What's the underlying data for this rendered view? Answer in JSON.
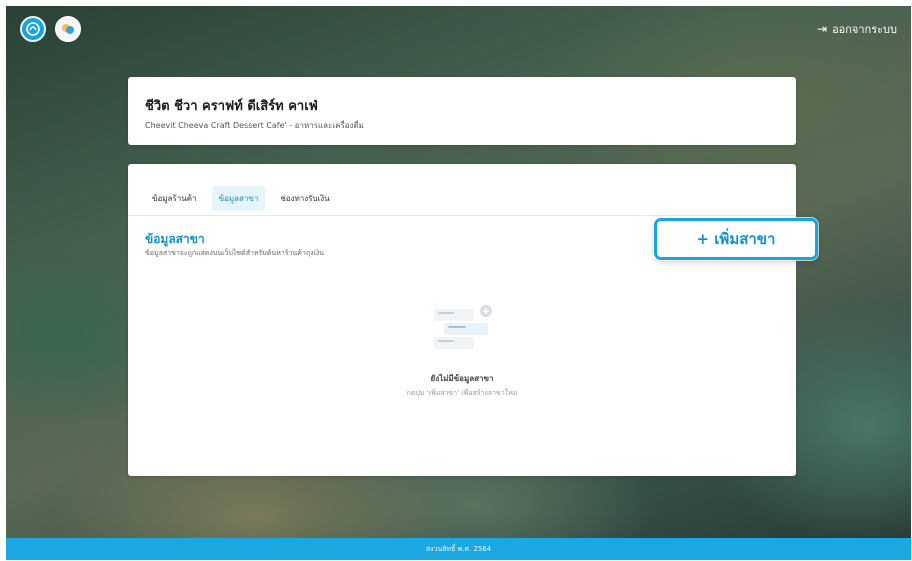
{
  "header": {
    "logos": [
      "bank-logo-icon",
      "merchant-logo-icon"
    ],
    "logout_label": "ออกจากระบบ",
    "logout_icon": "logout-icon"
  },
  "store": {
    "name": "ชีวิต ชีวา คราฟท์ ดีเสิร์ท คาเฟ่",
    "subtitle": "Cheevit Cheeva Craft Dessert Cafe' - อาหารและเครื่องดื่ม"
  },
  "tabs": [
    {
      "label": "ข้อมูลร้านค้า",
      "active": false
    },
    {
      "label": "ข้อมูลสาขา",
      "active": true
    },
    {
      "label": "ช่องทางรับเงิน",
      "active": false
    }
  ],
  "section": {
    "title": "ข้อมูลสาขา",
    "description": "ข้อมูลสาขาจะถูกแสดงบนเว็บไซต์สำหรับค้นหาร้านค้าถุงเงิน"
  },
  "add_button": {
    "label": "+ เพิ่มสาขา"
  },
  "empty_state": {
    "icon": "empty-list-icon",
    "title": "ยังไม่มีข้อมูลสาขา",
    "description": "กดปุ่ม 'เพิ่มสาขา' เพื่อสร้างสาขาใหม่"
  },
  "footer": {
    "text": "สงวนสิทธิ์ พ.ศ. 2564"
  },
  "colors": {
    "accent": "#1ba7df",
    "text_dark": "#1b1b1b",
    "tab_active_bg": "#e6f4fb"
  }
}
